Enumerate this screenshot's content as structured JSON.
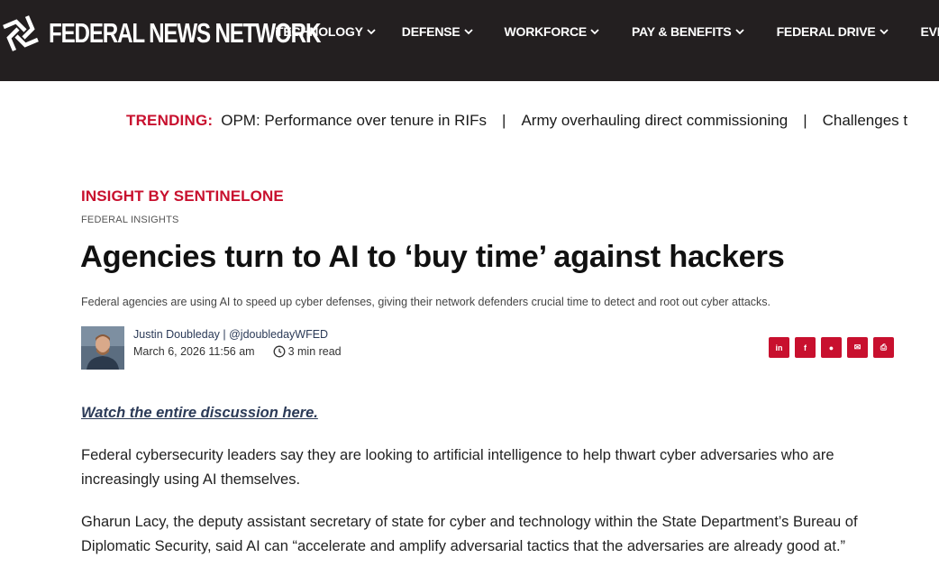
{
  "header": {
    "site_name": "FEDERAL NEWS NETWORK",
    "nav": [
      {
        "label": "TECHNOLOGY"
      },
      {
        "label": "DEFENSE"
      },
      {
        "label": "WORKFORCE"
      },
      {
        "label": "PAY & BENEFITS"
      },
      {
        "label": "FEDERAL DRIVE"
      },
      {
        "label": "EVENTS"
      }
    ]
  },
  "trending": {
    "label": "TRENDING:",
    "items": [
      "OPM: Performance over tenure in RIFs",
      "Army overhauling direct commissioning",
      "Challenges t"
    ],
    "separator": "|"
  },
  "article": {
    "kicker": "INSIGHT BY SENTINELONE",
    "category": "FEDERAL INSIGHTS",
    "headline": "Agencies turn to AI to ‘buy time’ against hackers",
    "dek": "Federal agencies are using AI to speed up cyber defenses, giving their network defenders crucial time to detect and root out cyber attacks.",
    "author": "Justin Doubleday",
    "author_sep": " | ",
    "author_handle": "@jdoubledayWFED",
    "date": "March 6, 2026 11:56 am",
    "read_time": "3 min read",
    "share": [
      {
        "icon": "linkedin-icon",
        "glyph": "in"
      },
      {
        "icon": "facebook-icon",
        "glyph": "f"
      },
      {
        "icon": "reddit-icon",
        "glyph": "●"
      },
      {
        "icon": "email-icon",
        "glyph": "✉"
      },
      {
        "icon": "print-icon",
        "glyph": "⎙"
      }
    ],
    "watch_link": "Watch the entire discussion here.",
    "paragraphs": [
      "Federal cybersecurity leaders say they are looking to artificial intelligence to help thwart cyber adversaries who are increasingly using AI themselves.",
      "Gharun Lacy, the deputy assistant secretary of state for cyber and technology within the State Department’s Bureau of Diplomatic Security, said AI can “accelerate and amplify adversarial tactics that the adversaries are already good at.”"
    ]
  },
  "colors": {
    "header_bg": "#231f20",
    "accent_red": "#c8102e",
    "link_blue": "#2b3a57"
  }
}
